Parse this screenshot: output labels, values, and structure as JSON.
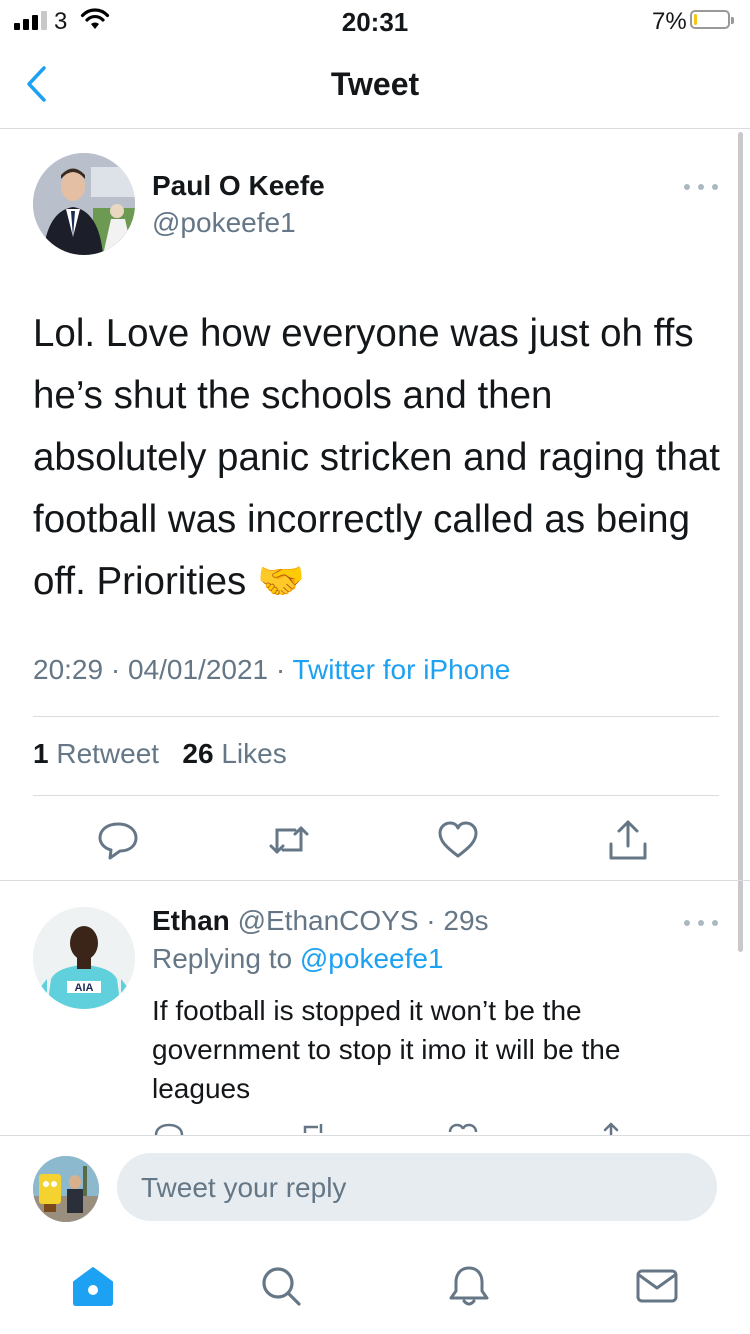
{
  "status_bar": {
    "carrier": "3",
    "time": "20:31",
    "battery_percent": "7%",
    "battery_level": 0.07
  },
  "nav": {
    "title": "Tweet",
    "back_icon": "chevron-left-icon"
  },
  "tweet": {
    "author_name": "Paul O Keefe",
    "author_handle": "@pokeefe1",
    "text": "Lol. Love how everyone was just oh ffs he’s shut the schools and then absolutely panic stricken and raging that football was incorrectly called as being off. Priorities 🤝",
    "time": "20:29",
    "date": "04/01/2021",
    "source": "Twitter for iPhone",
    "retweet_count": "1",
    "retweet_label": "Retweet",
    "like_count": "26",
    "like_label": "Likes"
  },
  "reply": {
    "author_name": "Ethan",
    "author_handle": "@EthanCOYS",
    "age": "29s",
    "replying_label": "Replying to",
    "replying_to": "@pokeefe1",
    "text": "If football is stopped it won’t be the government to stop it imo it will be the leagues"
  },
  "composer": {
    "placeholder": "Tweet your reply"
  },
  "colors": {
    "accent": "#1da1f2",
    "secondary_text": "#657786",
    "divider": "#d9dde0"
  },
  "tabs": [
    "home-icon",
    "search-icon",
    "notifications-icon",
    "messages-icon"
  ]
}
